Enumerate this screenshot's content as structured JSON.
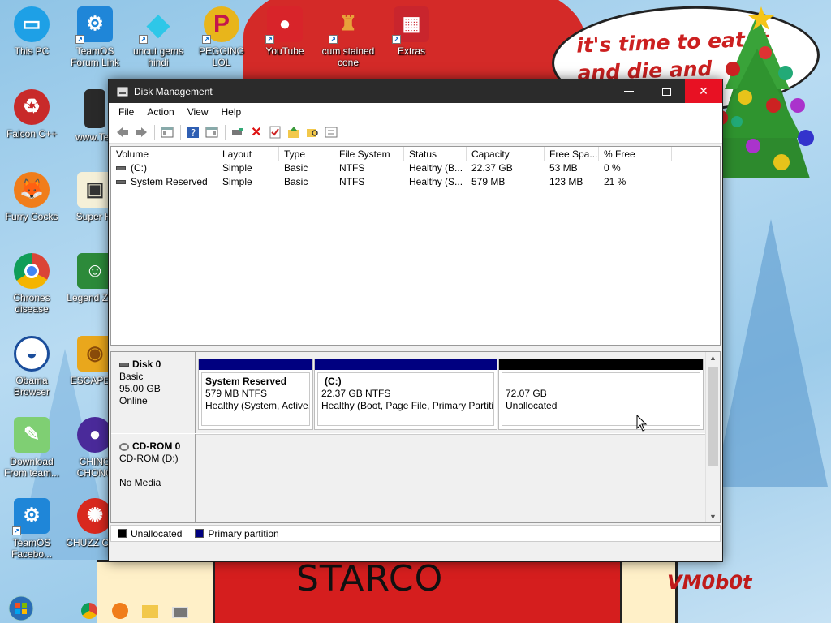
{
  "wallpaper": {
    "speech_text_line1": "it's time to eat it",
    "speech_text_line2": "and die and",
    "shirt_text": "STARCO",
    "signature": "VM0b0t"
  },
  "desktop_icons": [
    {
      "label": "This PC",
      "icon": "monitor-icon"
    },
    {
      "label": "TeamOS Forum Link",
      "icon": "gear-icon"
    },
    {
      "label": "uncut gems hindi",
      "icon": "diamond-icon"
    },
    {
      "label": "PEGGING LOL",
      "icon": "p-logo-icon"
    },
    {
      "label": "YouTube",
      "icon": "angry-bird-icon"
    },
    {
      "label": "cum stained cone",
      "icon": "character-icon"
    },
    {
      "label": "Extras",
      "icon": "box-icon"
    },
    {
      "label": "Falcon C++",
      "icon": "recycle-icon"
    },
    {
      "label": "www.Tea",
      "icon": "usb-icon"
    },
    {
      "label": "Furry Cocks",
      "icon": "firefox-icon"
    },
    {
      "label": "Super Hi",
      "icon": "pixel-icon"
    },
    {
      "label": "Chrones disease",
      "icon": "chrome-icon"
    },
    {
      "label": "Legend Zilda",
      "icon": "link-icon"
    },
    {
      "label": "Obama Browser",
      "icon": "obama-logo-icon"
    },
    {
      "label": "ESCAPE C",
      "icon": "puzzle-icon"
    },
    {
      "label": "Download From team...",
      "icon": "notepad-icon"
    },
    {
      "label": "CHING CHONG",
      "icon": "orb-icon"
    },
    {
      "label": "TeamOS Facebo...",
      "icon": "gear-icon"
    },
    {
      "label": "CHUZZ CUM",
      "icon": "chuzzle-icon"
    }
  ],
  "window": {
    "title": "Disk Management",
    "menu": [
      "File",
      "Action",
      "View",
      "Help"
    ],
    "columns": [
      "Volume",
      "Layout",
      "Type",
      "File System",
      "Status",
      "Capacity",
      "Free Spa...",
      "% Free"
    ],
    "volumes": [
      {
        "volume": "(C:)",
        "layout": "Simple",
        "type": "Basic",
        "fs": "NTFS",
        "status": "Healthy (B...",
        "capacity": "22.37 GB",
        "free": "53 MB",
        "pct": "0 %"
      },
      {
        "volume": "System Reserved",
        "layout": "Simple",
        "type": "Basic",
        "fs": "NTFS",
        "status": "Healthy (S...",
        "capacity": "579 MB",
        "free": "123 MB",
        "pct": "21 %"
      }
    ],
    "disk0": {
      "name": "Disk 0",
      "type": "Basic",
      "size": "95.00 GB",
      "state": "Online",
      "partitions": [
        {
          "name": "System Reserved",
          "detail": "579 MB NTFS",
          "status": "Healthy (System, Active,",
          "bar_color": "#000080"
        },
        {
          "name": "(C:)",
          "detail": "22.37 GB NTFS",
          "status": "Healthy (Boot, Page File, Primary Partitic",
          "bar_color": "#000080"
        },
        {
          "name": "",
          "detail": "72.07 GB",
          "status": "Unallocated",
          "bar_color": "#000000"
        }
      ]
    },
    "cdrom0": {
      "name": "CD-ROM 0",
      "drive": "CD-ROM (D:)",
      "media": "No Media"
    },
    "legend": [
      {
        "label": "Unallocated",
        "color": "#000000"
      },
      {
        "label": "Primary partition",
        "color": "#000080"
      }
    ]
  }
}
